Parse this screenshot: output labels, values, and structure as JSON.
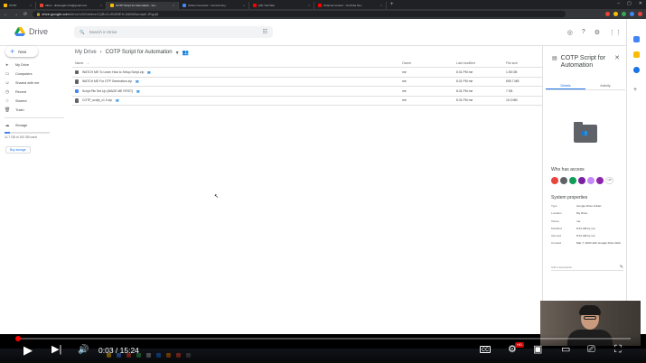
{
  "browser": {
    "tabs": [
      {
        "title": "COTP",
        "color": "#fbbc04"
      },
      {
        "title": "Inbox - diwreagan.info@gmail.com",
        "color": "#ea4335"
      },
      {
        "title": "COTP Script for Automation - Go...",
        "color": "#fbbc04"
      },
      {
        "title": "Online Converter - Convert Any...",
        "color": "#4285f4"
      },
      {
        "title": "(23) YouTube",
        "color": "#ff0000"
      },
      {
        "title": "Channel content - YouTube Stu...",
        "color": "#ff0000"
      }
    ],
    "new_tab": "+",
    "url_host": "drive.google.com",
    "url_path": "/drive/u/0/folders/1QBvCuf94BfEN-5d6N8wmjaK-fRgzj8",
    "ext_colors": [
      "#ea4335",
      "#fbbc04",
      "#34a853",
      "#4285f4",
      "#e8453c"
    ]
  },
  "header": {
    "logo_text": "Drive",
    "search_placeholder": "Search in Drive",
    "icons": [
      "check-circle-icon",
      "help-icon",
      "settings-icon",
      "apps-icon"
    ]
  },
  "sidebar": {
    "new_label": "New",
    "items": [
      {
        "label": "My Drive",
        "icon": "▸"
      },
      {
        "label": "Computers",
        "icon": "▭"
      },
      {
        "label": "Shared with me",
        "icon": "☺"
      },
      {
        "label": "Recent",
        "icon": "◷"
      },
      {
        "label": "Starred",
        "icon": "☆"
      },
      {
        "label": "Trash",
        "icon": "🗑"
      }
    ],
    "storage_label": "Storage",
    "storage_text": "11.7 GB of 100 GB used",
    "storage_fraction": 0.117,
    "buy_label": "Buy storage"
  },
  "main": {
    "breadcrumb_root": "My Drive",
    "breadcrumb_current": "COTP Script for Automation",
    "columns": {
      "name": "Name",
      "owner": "Owner",
      "modified": "Last modified",
      "size": "File size"
    },
    "files": [
      {
        "name": "WATCH ME To Learn How to Setup Script.zip",
        "owner": "me",
        "modified": "8:31 PM me",
        "size": "1.55 GB",
        "type": "zip"
      },
      {
        "name": "WATCH ME For OTP Generation.zip",
        "owner": "me",
        "modified": "8:31 PM me",
        "size": "695.7 MB",
        "type": "zip"
      },
      {
        "name": "Script File Set Up (MADE ME FIRST)",
        "owner": "me",
        "modified": "8:31 PM me",
        "size": "7 KB",
        "type": "img"
      },
      {
        "name": "COTP_script_v1.0.zip",
        "owner": "me",
        "modified": "8:31 PM me",
        "size": "15.3 MB",
        "type": "zip"
      }
    ]
  },
  "details": {
    "title": "COTP Script for Automation",
    "tabs": [
      "Details",
      "Activity"
    ],
    "who_has_access": "Who has access",
    "share_colors": [
      "#e8453c",
      "#5f6368",
      "#0f9d58",
      "#7b1fa2",
      "#c58af9",
      "#8e24aa"
    ],
    "more_label": "+99",
    "system_properties": "System properties",
    "props": [
      {
        "k": "Type",
        "v": "Google Drive Folder"
      },
      {
        "k": "Location",
        "v": "My Drive"
      },
      {
        "k": "Owner",
        "v": "me"
      },
      {
        "k": "Modified",
        "v": "8:31 AM by me"
      },
      {
        "k": "Opened",
        "v": "8:31 AM by me"
      },
      {
        "k": "Created",
        "v": "Mar 7, 2023 with Google Drive Web"
      }
    ],
    "description_placeholder": "Add a description"
  },
  "player": {
    "time": "0:03 / 15:24",
    "progress_fraction": 0.0032,
    "notification_count": "HD"
  }
}
